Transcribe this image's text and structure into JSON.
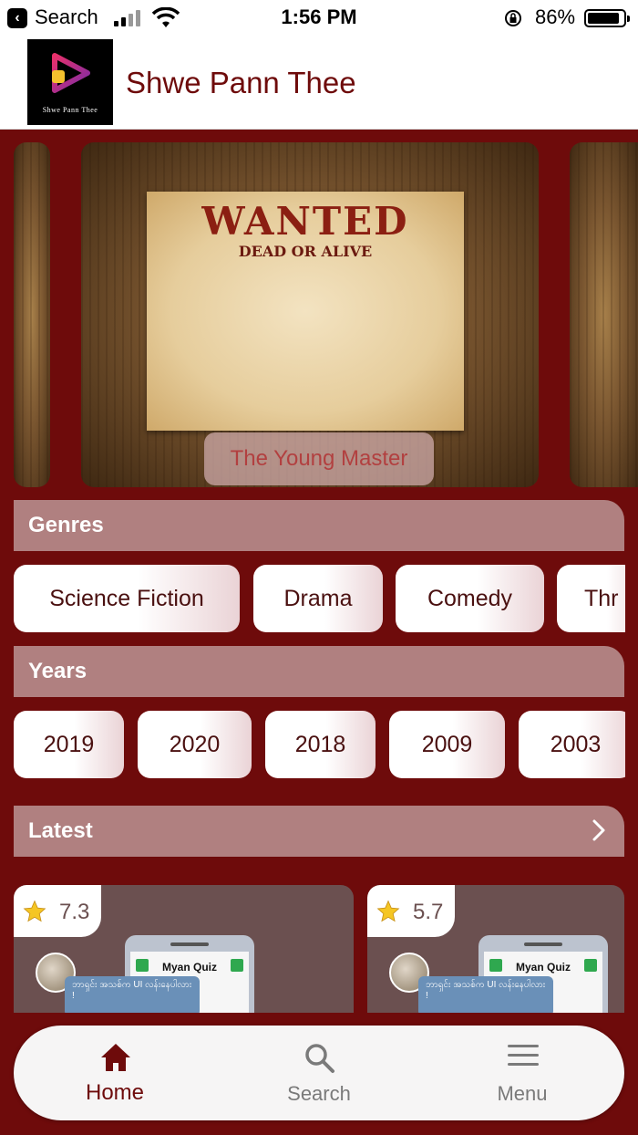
{
  "status_bar": {
    "back_label": "Search",
    "time": "1:56 PM",
    "battery": "86%"
  },
  "header": {
    "logo_text": "Shwe Pann Thee",
    "title": "Shwe Pann Thee"
  },
  "carousel": {
    "poster_headline": "WANTED",
    "poster_subline": "DEAD OR ALIVE",
    "caption": "The Young Master"
  },
  "genres": {
    "title": "Genres",
    "items": [
      "Science Fiction",
      "Drama",
      "Comedy",
      "Thr"
    ]
  },
  "years": {
    "title": "Years",
    "items": [
      "2019",
      "2020",
      "2018",
      "2009",
      "2003"
    ]
  },
  "latest": {
    "title": "Latest",
    "cards": [
      {
        "rating": "7.3",
        "app_title": "Myan Quiz",
        "bubble": "ဘာရှင်း အသစ်က UI လန်းနေပါလား !"
      },
      {
        "rating": "5.7",
        "app_title": "Myan Quiz",
        "bubble": "ဘာရှင်း အသစ်က UI လန်းနေပါလား !"
      }
    ]
  },
  "nav": {
    "home": "Home",
    "search": "Search",
    "menu": "Menu",
    "active": "home"
  },
  "colors": {
    "brand": "#6e0b0b",
    "section": "#b08080",
    "card": "#6b5050"
  }
}
